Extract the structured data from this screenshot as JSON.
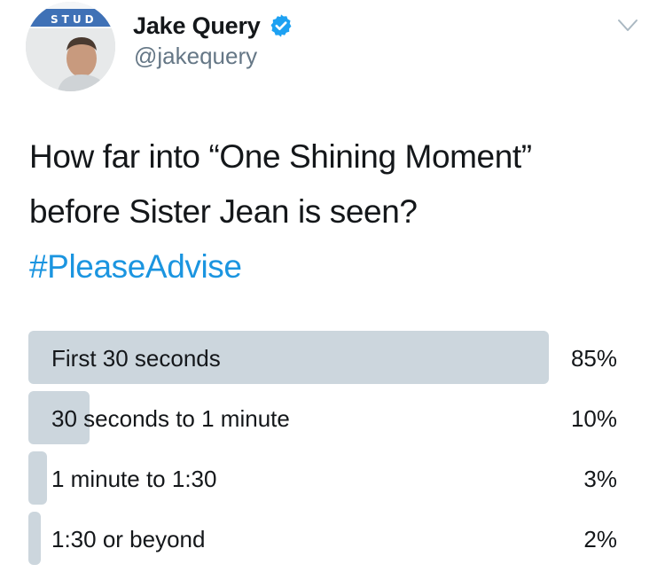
{
  "author": {
    "display_name": "Jake Query",
    "handle": "@jakequery",
    "verified": true,
    "avatar_text": "STUD"
  },
  "tweet": {
    "lines": [
      "How far into “One Shining Moment”",
      "before Sister Jean is seen?"
    ],
    "hashtag": "#PleaseAdvise"
  },
  "poll": {
    "options": [
      {
        "label": "First 30 seconds",
        "percent_text": "85%",
        "percent": 85
      },
      {
        "label": "30 seconds to 1 minute",
        "percent_text": "10%",
        "percent": 10
      },
      {
        "label": "1 minute to 1:30",
        "percent_text": "3%",
        "percent": 3
      },
      {
        "label": "1:30 or beyond",
        "percent_text": "2%",
        "percent": 2
      }
    ]
  },
  "colors": {
    "text": "#14171a",
    "secondary_text": "#657786",
    "link": "#1b95e0",
    "verified_badge": "#1da1f2",
    "poll_bar": "#ccd6dd"
  },
  "icons": {
    "verified": "verified-badge-icon",
    "menu": "chevron-down-icon"
  }
}
